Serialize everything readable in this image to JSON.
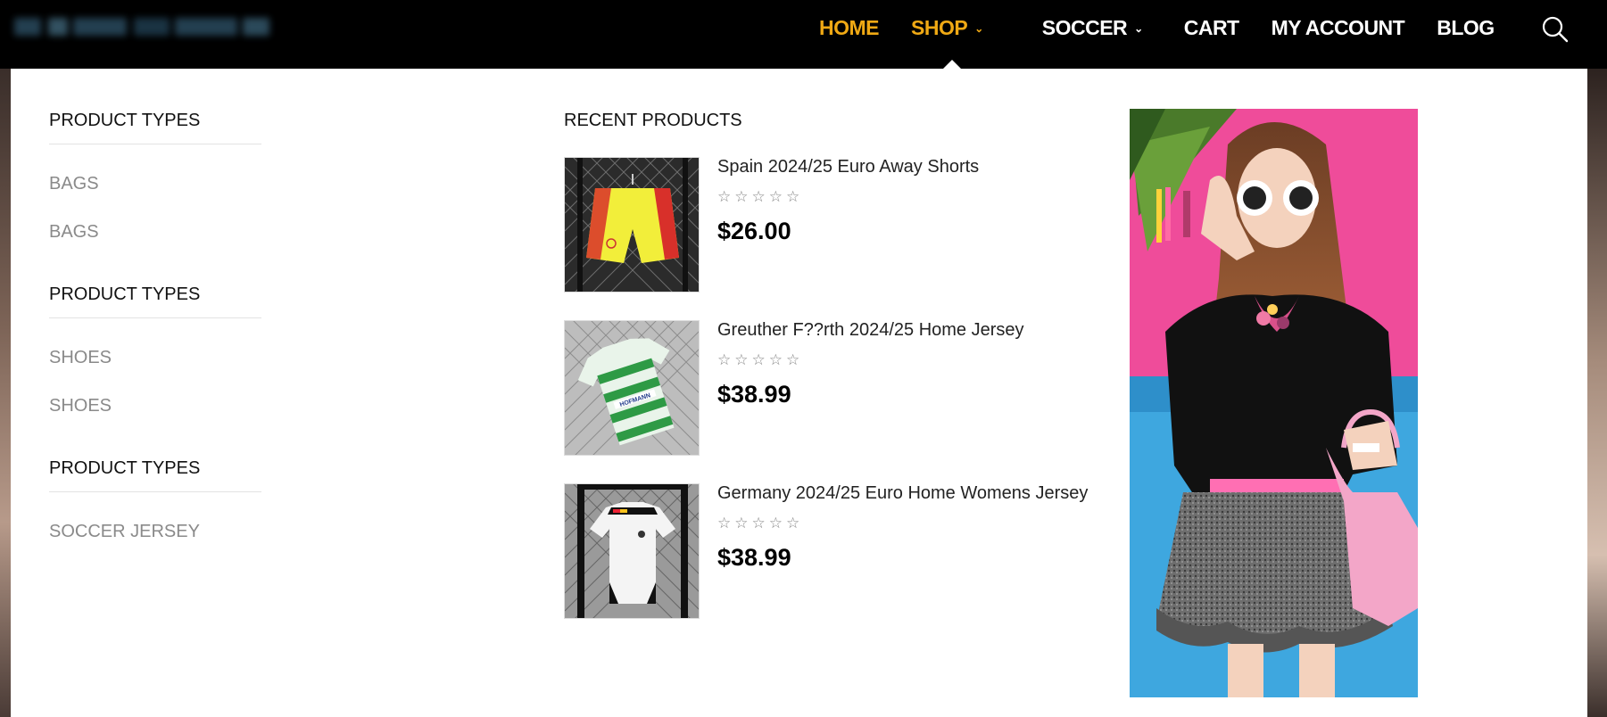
{
  "header": {
    "nav": [
      {
        "label": "HOME",
        "active": true,
        "has_dropdown": false
      },
      {
        "label": "SHOP",
        "active": true,
        "has_dropdown": true
      },
      {
        "label": "SOCCER",
        "active": false,
        "has_dropdown": true
      },
      {
        "label": "CART",
        "active": false,
        "has_dropdown": false
      },
      {
        "label": "MY ACCOUNT",
        "active": false,
        "has_dropdown": false
      },
      {
        "label": "BLOG",
        "active": false,
        "has_dropdown": false
      }
    ],
    "search_icon": "search-icon",
    "accent_color": "#f0a914"
  },
  "mega_menu": {
    "groups": [
      {
        "title": "PRODUCT TYPES",
        "links": [
          "BAGS",
          "BAGS"
        ]
      },
      {
        "title": "PRODUCT TYPES",
        "links": [
          "SHOES",
          "SHOES"
        ]
      },
      {
        "title": "PRODUCT TYPES",
        "links": [
          "SOCCER JERSEY"
        ]
      }
    ],
    "recent_title": "RECENT PRODUCTS",
    "products": [
      {
        "name": "Spain 2024/25 Euro Away Shorts",
        "price": "$26.00",
        "rating": 0,
        "max_rating": 5
      },
      {
        "name": "Greuther F??rth 2024/25 Home Jersey",
        "price": "$38.99",
        "rating": 0,
        "max_rating": 5
      },
      {
        "name": "Germany 2024/25 Euro Home Womens Jersey",
        "price": "$38.99",
        "rating": 0,
        "max_rating": 5
      }
    ]
  }
}
